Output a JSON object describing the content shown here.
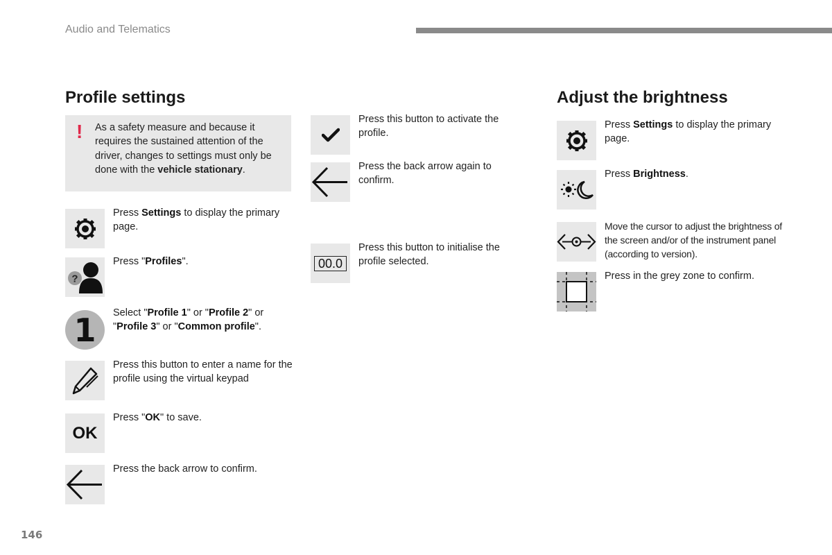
{
  "header": {
    "section_label": "Audio and Telematics",
    "page_number": "146"
  },
  "profile_settings": {
    "title": "Profile settings",
    "warning": {
      "icon": "exclamation-icon",
      "icon_glyph": "!",
      "text_before": "As a safety measure and because it requires the sustained attention of the driver, changes to settings must only be done with the ",
      "text_bold": "vehicle stationary",
      "text_after": "."
    },
    "steps": [
      {
        "icon": "settings-gear-icon",
        "text_before": "Press ",
        "bold": "Settings",
        "text_after": " to display the primary page."
      },
      {
        "icon": "profile-user-icon",
        "text_before": "Press \"",
        "bold": "Profiles",
        "text_after": "\"."
      },
      {
        "icon": "number-1-icon",
        "icon_label": "1",
        "parts": [
          "Select \"",
          "Profile 1",
          "\" or \"",
          "Profile 2",
          "\" or \"",
          "Profile 3",
          "\" or \"",
          "Common profile",
          "\"."
        ]
      },
      {
        "icon": "pencil-icon",
        "text": "Press this button to enter a name for the profile using the virtual keypad"
      },
      {
        "icon": "ok-icon",
        "icon_label": "OK",
        "text_before": "Press \"",
        "bold": "OK",
        "text_after": "\" to save."
      },
      {
        "icon": "back-arrow-icon",
        "text": "Press the back arrow to confirm."
      }
    ],
    "middle_steps": [
      {
        "icon": "checkmark-icon",
        "text": "Press this button to activate the profile."
      },
      {
        "icon": "back-arrow-icon",
        "text": "Press the back arrow again to confirm."
      },
      {
        "icon": "reset-counter-icon",
        "icon_label": "00.0",
        "text": "Press this button to initialise the profile selected."
      }
    ]
  },
  "brightness": {
    "title": "Adjust the brightness",
    "steps": [
      {
        "icon": "settings-gear-icon",
        "text_before": "Press ",
        "bold": "Settings",
        "text_after": " to display the primary page."
      },
      {
        "icon": "brightness-sun-moon-icon",
        "text_before": "Press ",
        "bold": "Brightness",
        "text_after": "."
      },
      {
        "icon": "slider-cursor-icon",
        "text": "Move the cursor to adjust the brightness of the screen and/or of the instrument panel (according to version)."
      },
      {
        "icon": "grey-zone-icon",
        "text": "Press in the grey zone to confirm."
      }
    ]
  },
  "colors": {
    "warning_accent": "#e0284a",
    "icon_background": "#e8e8e8",
    "header_rule": "#8a8a8a"
  }
}
